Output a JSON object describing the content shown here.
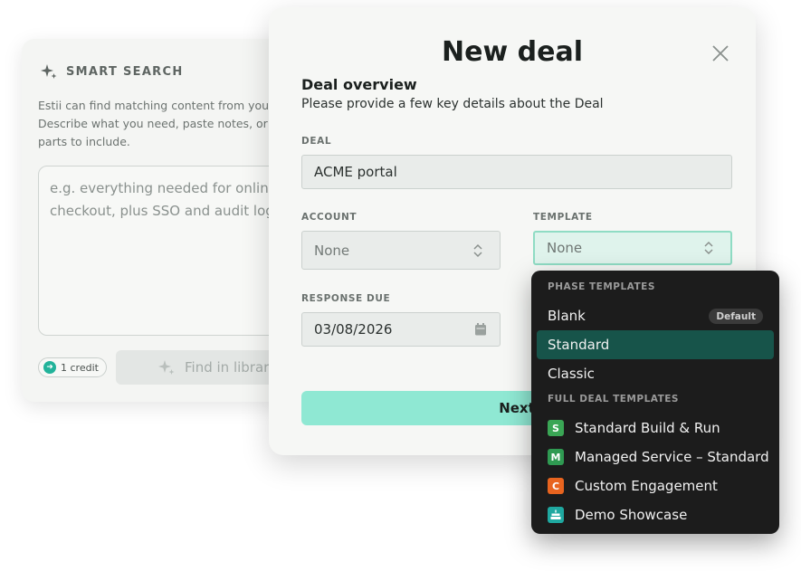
{
  "smart_search": {
    "title": "SMART SEARCH",
    "description": [
      "Estii can find matching content from your library.",
      "Describe what you need, paste notes, or list the",
      "parts to include."
    ],
    "placeholder_lines": [
      "e.g. everything needed for online",
      "checkout, plus SSO and audit logging"
    ],
    "credit_label": "1 credit",
    "find_button_label": "Find in library"
  },
  "modal": {
    "title": "New deal",
    "overview_heading": "Deal overview",
    "overview_text": "Please provide a few key details about the Deal",
    "deal_label": "DEAL",
    "deal_value": "ACME portal",
    "account_label": "ACCOUNT",
    "account_value": "None",
    "template_label": "TEMPLATE",
    "template_value": "None",
    "response_due_label": "RESPONSE DUE",
    "response_due_value": "03/08/2026",
    "next_label": "Next"
  },
  "dropdown": {
    "phase_group_label": "PHASE TEMPLATES",
    "phase_templates": [
      {
        "label": "Blank",
        "badge": "Default",
        "selected": false
      },
      {
        "label": "Standard",
        "badge": "",
        "selected": true
      },
      {
        "label": "Classic",
        "badge": "",
        "selected": false
      }
    ],
    "full_group_label": "FULL DEAL TEMPLATES",
    "full_templates": [
      {
        "letter": "S",
        "label": "Standard Build & Run",
        "color": "#3aa655"
      },
      {
        "letter": "M",
        "label": "Managed Service – Standard",
        "color": "#2f9a52"
      },
      {
        "letter": "C",
        "label": "Custom Engagement",
        "color": "#e8641f"
      },
      {
        "letter": "",
        "label": "Demo Showcase",
        "color": "#1fa8a0"
      }
    ]
  },
  "colors": {
    "accent": "#8fe8d3",
    "selected_row": "#17544a",
    "dropdown_bg": "#1c1c1c"
  }
}
